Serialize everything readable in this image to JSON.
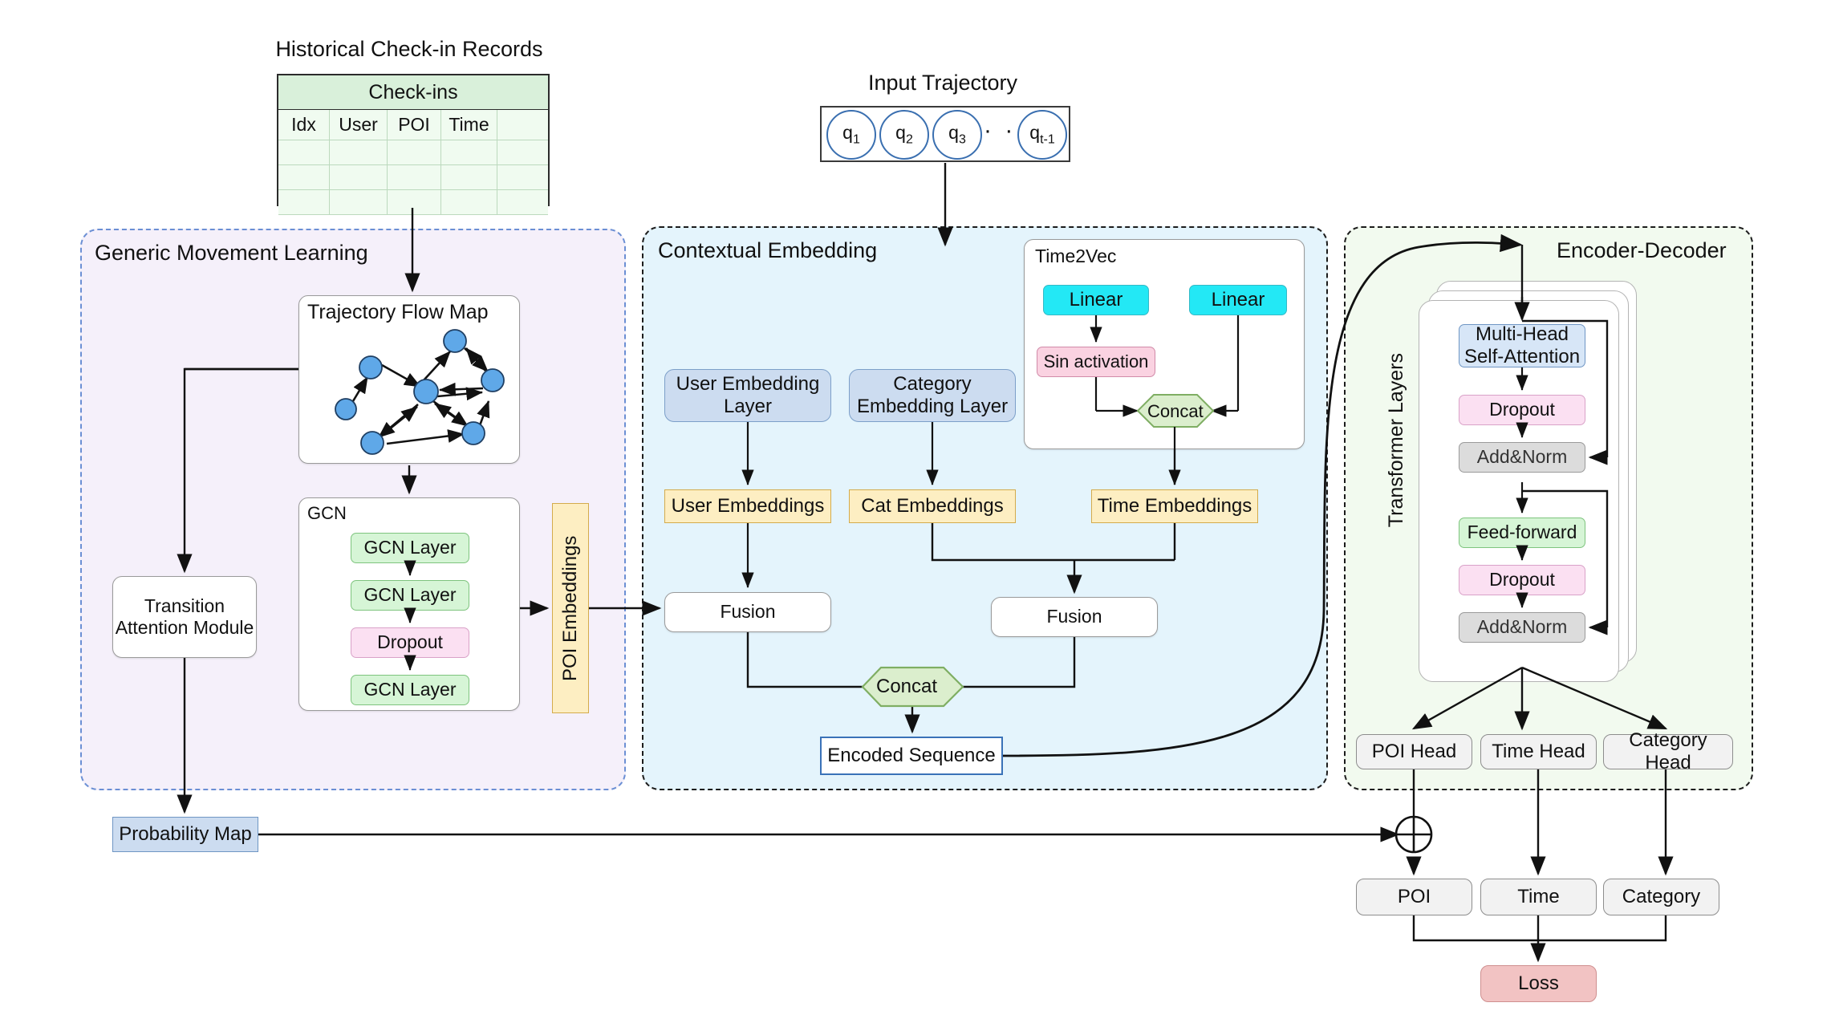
{
  "headers": {
    "historical": "Historical Check-in Records",
    "input_trajectory": "Input Trajectory"
  },
  "checkin_table": {
    "title": "Check-ins",
    "columns": [
      "Idx",
      "User",
      "POI",
      "Time",
      ""
    ],
    "empty_rows": 3
  },
  "trajectory": {
    "items": [
      "q",
      "q",
      "q",
      "q"
    ],
    "subscripts": [
      "1",
      "2",
      "3",
      "t-1"
    ],
    "ellipsis": "· · ·"
  },
  "panels": {
    "gml": "Generic Movement Learning",
    "ctx": "Contextual Embedding",
    "enc": "Encoder-Decoder"
  },
  "gml": {
    "flow_map_title": "Trajectory Flow Map",
    "gcn_title": "GCN",
    "gcn_layers": [
      "GCN Layer",
      "GCN Layer",
      "Dropout",
      "GCN Layer"
    ],
    "transition": "Transition\nAttention Module",
    "transition_line1": "Transition",
    "transition_line2": "Attention Module",
    "poi_embeddings": "POI Embeddings"
  },
  "ctx": {
    "user_embedding_layer_l1": "User Embedding",
    "user_embedding_layer_l2": "Layer",
    "category_embedding_layer_l1": "Category",
    "category_embedding_layer_l2": "Embedding Layer",
    "time2vec_title": "Time2Vec",
    "linear_left": "Linear",
    "linear_right": "Linear",
    "sin_activation": "Sin activation",
    "t2v_concat": "Concat",
    "user_embeddings": "User Embeddings",
    "cat_embeddings": "Cat Embeddings",
    "time_embeddings": "Time Embeddings",
    "fusion_left": "Fusion",
    "fusion_right": "Fusion",
    "concat": "Concat",
    "encoded_sequence": "Encoded Sequence"
  },
  "enc": {
    "transformer_layers_label": "Transformer Layers",
    "multi_head_l1": "Multi-Head",
    "multi_head_l2": "Self-Attention",
    "dropout_1": "Dropout",
    "addnorm_1": "Add&Norm",
    "feed_forward": "Feed-forward",
    "dropout_2": "Dropout",
    "addnorm_2": "Add&Norm",
    "heads": [
      "POI Head",
      "Time Head",
      "Category Head"
    ]
  },
  "outputs": {
    "probability_map": "Probability Map",
    "poi": "POI",
    "time": "Time",
    "category": "Category",
    "loss": "Loss",
    "sum_symbol": "+"
  },
  "colors": {
    "gml_panel": "#f5f0fa",
    "ctx_panel": "#e4f4fc",
    "enc_panel": "#f2faef",
    "green": "#d6f5d6",
    "pink": "#fbe0f2",
    "cyan": "#23e8f5",
    "amber": "#fdeec2",
    "blue": "#ccdcf0",
    "grey": "#dcdcdc",
    "red": "#f2c3c3",
    "node_blue": "#5fa8e8"
  },
  "chart_data": {
    "type": "diagram",
    "title": "POI Recommendation Model Architecture",
    "flow_map_nodes": 7,
    "transformer_stack_count": 3
  }
}
